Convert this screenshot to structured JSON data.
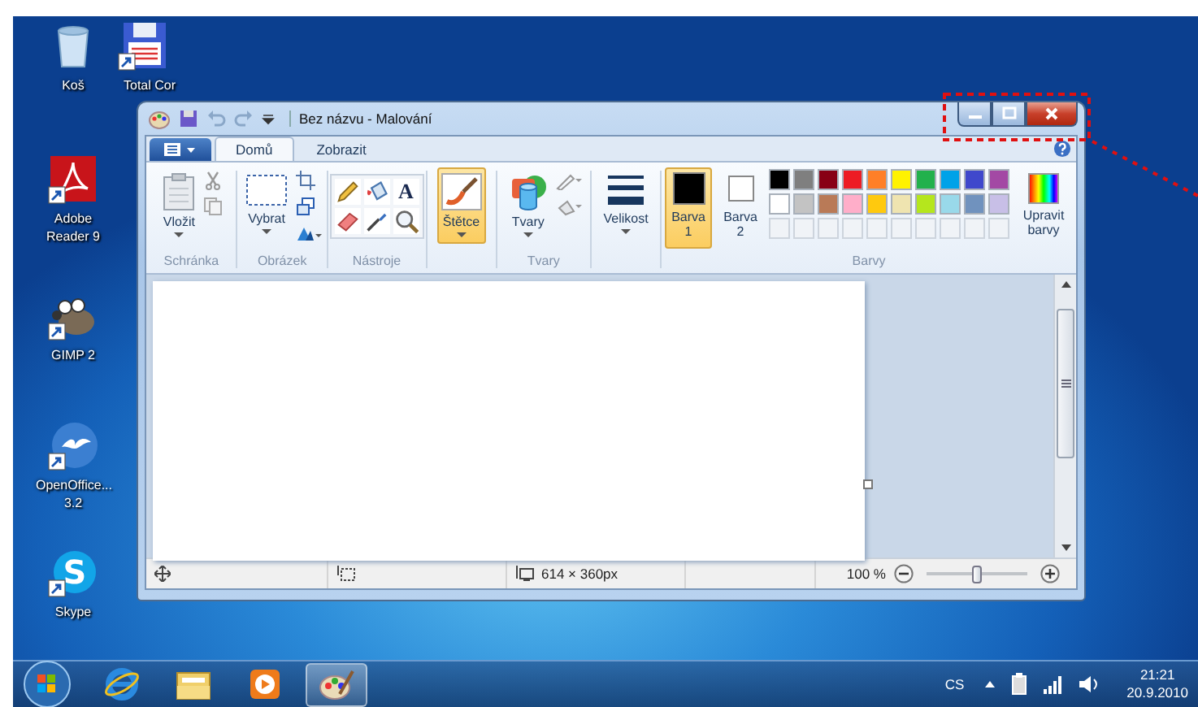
{
  "desktop": {
    "icons": [
      {
        "kind": "recycle-bin",
        "label": "Koš"
      },
      {
        "kind": "floppy",
        "label": "Total Cor"
      },
      {
        "kind": "pdf",
        "label": "Adobe Reader 9"
      },
      {
        "kind": "gimp",
        "label": "GIMP 2"
      },
      {
        "kind": "office",
        "label": "OpenOffice... 3.2"
      },
      {
        "kind": "skype",
        "label": "Skype",
        "glyph": "S"
      }
    ]
  },
  "paint_window": {
    "title": "Bez názvu - Malování",
    "tabs": [
      {
        "label": "Domů",
        "selected": true
      },
      {
        "label": "Zobrazit",
        "selected": false
      }
    ],
    "ribbon": {
      "clipboard": {
        "label": "Schránka",
        "paste": "Vložit"
      },
      "image": {
        "label": "Obrázek",
        "select": "Vybrat"
      },
      "tools": {
        "label": "Nástroje",
        "text_glyph": "A"
      },
      "brushes": {
        "button": "Štětce",
        "selected": true
      },
      "shapes": {
        "label": "Tvary",
        "button": "Tvary"
      },
      "size": {
        "button": "Velikost"
      },
      "colors": {
        "label": "Barvy",
        "edit": "Upravit barvy",
        "slots": [
          {
            "label": "Barva 1",
            "color": "#000000",
            "selected": true
          },
          {
            "label": "Barva 2",
            "color": "#ffffff",
            "selected": false
          }
        ],
        "palette": [
          {
            "color": "#000000"
          },
          {
            "color": "#7f7f7f"
          },
          {
            "color": "#880015"
          },
          {
            "color": "#ed1c24"
          },
          {
            "color": "#ff7f27"
          },
          {
            "color": "#fff200"
          },
          {
            "color": "#22b14c"
          },
          {
            "color": "#00a2e8"
          },
          {
            "color": "#3f48cc"
          },
          {
            "color": "#a349a4"
          },
          {
            "color": "#ffffff"
          },
          {
            "color": "#c3c3c3"
          },
          {
            "color": "#b97a57"
          },
          {
            "color": "#ffaec9"
          },
          {
            "color": "#ffc90e"
          },
          {
            "color": "#efe4b0"
          },
          {
            "color": "#b5e61d"
          },
          {
            "color": "#99d9ea"
          },
          {
            "color": "#7092be"
          },
          {
            "color": "#c8bfe7"
          }
        ]
      }
    },
    "status_bar": {
      "canvas_size": "614 × 360px",
      "zoom": "100 %",
      "zoom_slider": {
        "level": 0.5
      }
    }
  },
  "taskbar": {
    "items": [
      {
        "kind": "browser",
        "selected": false
      },
      {
        "kind": "folder",
        "selected": false
      },
      {
        "kind": "media",
        "selected": false
      },
      {
        "kind": "paint",
        "selected": true
      }
    ],
    "language": "CS",
    "time": "21:21",
    "date": "20.9.2010"
  }
}
